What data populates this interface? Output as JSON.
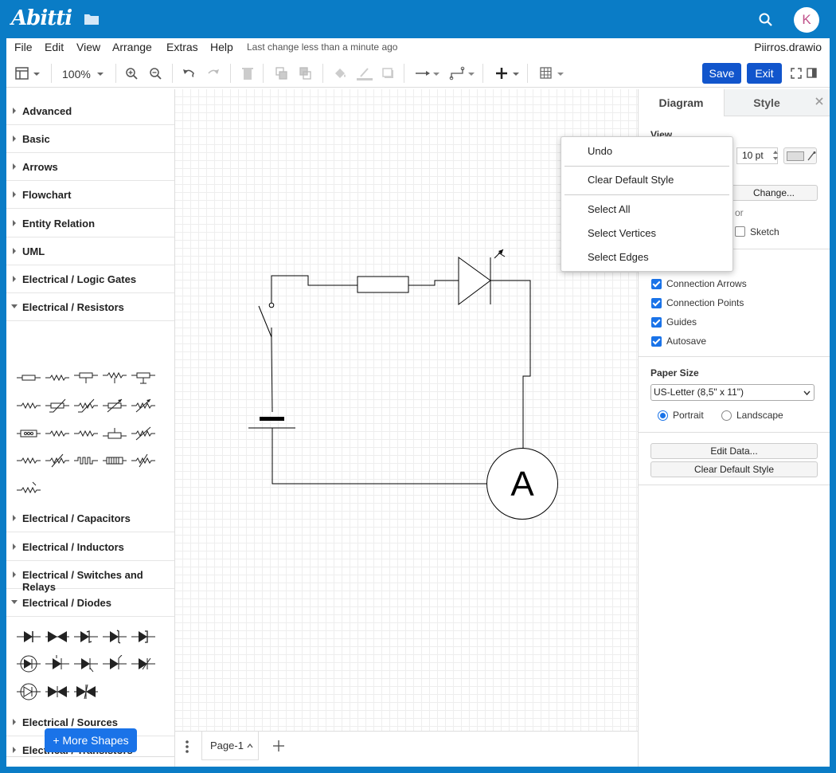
{
  "topbar": {
    "logo": "Abitti"
  },
  "user": {
    "initial": "K"
  },
  "menubar": {
    "items": [
      "File",
      "Edit",
      "View",
      "Arrange",
      "Extras",
      "Help"
    ],
    "last_change": "Last change less than a minute ago",
    "filename": "Piirros.drawio"
  },
  "toolbar": {
    "zoom": "100%",
    "save": "Save",
    "exit": "Exit"
  },
  "sidebar": {
    "sections": [
      "Advanced",
      "Basic",
      "Arrows",
      "Flowchart",
      "Entity Relation",
      "UML",
      "Electrical / Logic Gates",
      "Electrical / Resistors",
      "Electrical / Capacitors",
      "Electrical / Inductors",
      "Electrical / Switches and Relays",
      "Electrical / Diodes",
      "Electrical / Sources",
      "Electrical / Transistors"
    ],
    "more_shapes": "More Shapes"
  },
  "canvas": {
    "ammeter_label": "A"
  },
  "pagebar": {
    "page": "Page-1"
  },
  "format_panel": {
    "tabs": [
      "Diagram",
      "Style"
    ],
    "view_title": "View",
    "grid_size": "10 pt",
    "change_button": "Change...",
    "background_partial": "or",
    "sketch": "Sketch",
    "options": [
      "Connection Arrows",
      "Connection Points",
      "Guides",
      "Autosave"
    ],
    "paper_size_title": "Paper Size",
    "paper_size": "US-Letter (8,5\" x 11\")",
    "portrait": "Portrait",
    "landscape": "Landscape",
    "edit_data": "Edit Data...",
    "clear_default_style": "Clear Default Style"
  },
  "context_menu": {
    "items": [
      "Undo",
      "Clear Default Style",
      "Select All",
      "Select Vertices",
      "Select Edges"
    ]
  }
}
